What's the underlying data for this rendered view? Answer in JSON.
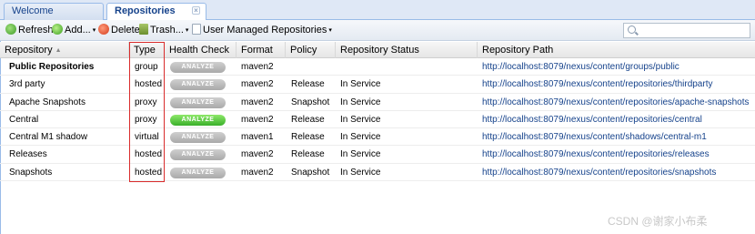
{
  "tabs": [
    {
      "label": "Welcome"
    },
    {
      "label": "Repositories"
    }
  ],
  "tab_close_glyph": "×",
  "toolbar": {
    "refresh_label": "Refresh",
    "add_label": "Add...",
    "delete_label": "Delete",
    "trash_label": "Trash...",
    "user_managed_label": "User Managed Repositories",
    "caret": "▾",
    "search_placeholder": ""
  },
  "grid": {
    "sort_glyph": "▲",
    "columns": [
      "Repository",
      "Type",
      "Health Check",
      "Format",
      "Policy",
      "Repository Status",
      "Repository Path"
    ],
    "rows": [
      {
        "name": "Public Repositories",
        "type": "group",
        "health": "ANALYZE",
        "format": "maven2",
        "policy": "",
        "status": "",
        "path": "http://localhost:8079/nexus/content/groups/public"
      },
      {
        "name": "3rd party",
        "type": "hosted",
        "health": "ANALYZE",
        "format": "maven2",
        "policy": "Release",
        "status": "In Service",
        "path": "http://localhost:8079/nexus/content/repositories/thirdparty"
      },
      {
        "name": "Apache Snapshots",
        "type": "proxy",
        "health": "ANALYZE",
        "format": "maven2",
        "policy": "Snapshot",
        "status": "In Service",
        "path": "http://localhost:8079/nexus/content/repositories/apache-snapshots"
      },
      {
        "name": "Central",
        "type": "proxy",
        "health": "ANALYZE",
        "format": "maven2",
        "policy": "Release",
        "status": "In Service",
        "path": "http://localhost:8079/nexus/content/repositories/central"
      },
      {
        "name": "Central M1 shadow",
        "type": "virtual",
        "health": "ANALYZE",
        "format": "maven1",
        "policy": "Release",
        "status": "In Service",
        "path": "http://localhost:8079/nexus/content/shadows/central-m1"
      },
      {
        "name": "Releases",
        "type": "hosted",
        "health": "ANALYZE",
        "format": "maven2",
        "policy": "Release",
        "status": "In Service",
        "path": "http://localhost:8079/nexus/content/repositories/releases"
      },
      {
        "name": "Snapshots",
        "type": "hosted",
        "health": "ANALYZE",
        "format": "maven2",
        "policy": "Snapshot",
        "status": "In Service",
        "path": "http://localhost:8079/nexus/content/repositories/snapshots"
      }
    ]
  },
  "watermark": "CSDN @谢家小布柔",
  "colors": {
    "analyze_default": "#b5b5b5",
    "analyze_active": "#4cc23a",
    "type_highlight": "#d92b2b",
    "link": "#15428b"
  }
}
